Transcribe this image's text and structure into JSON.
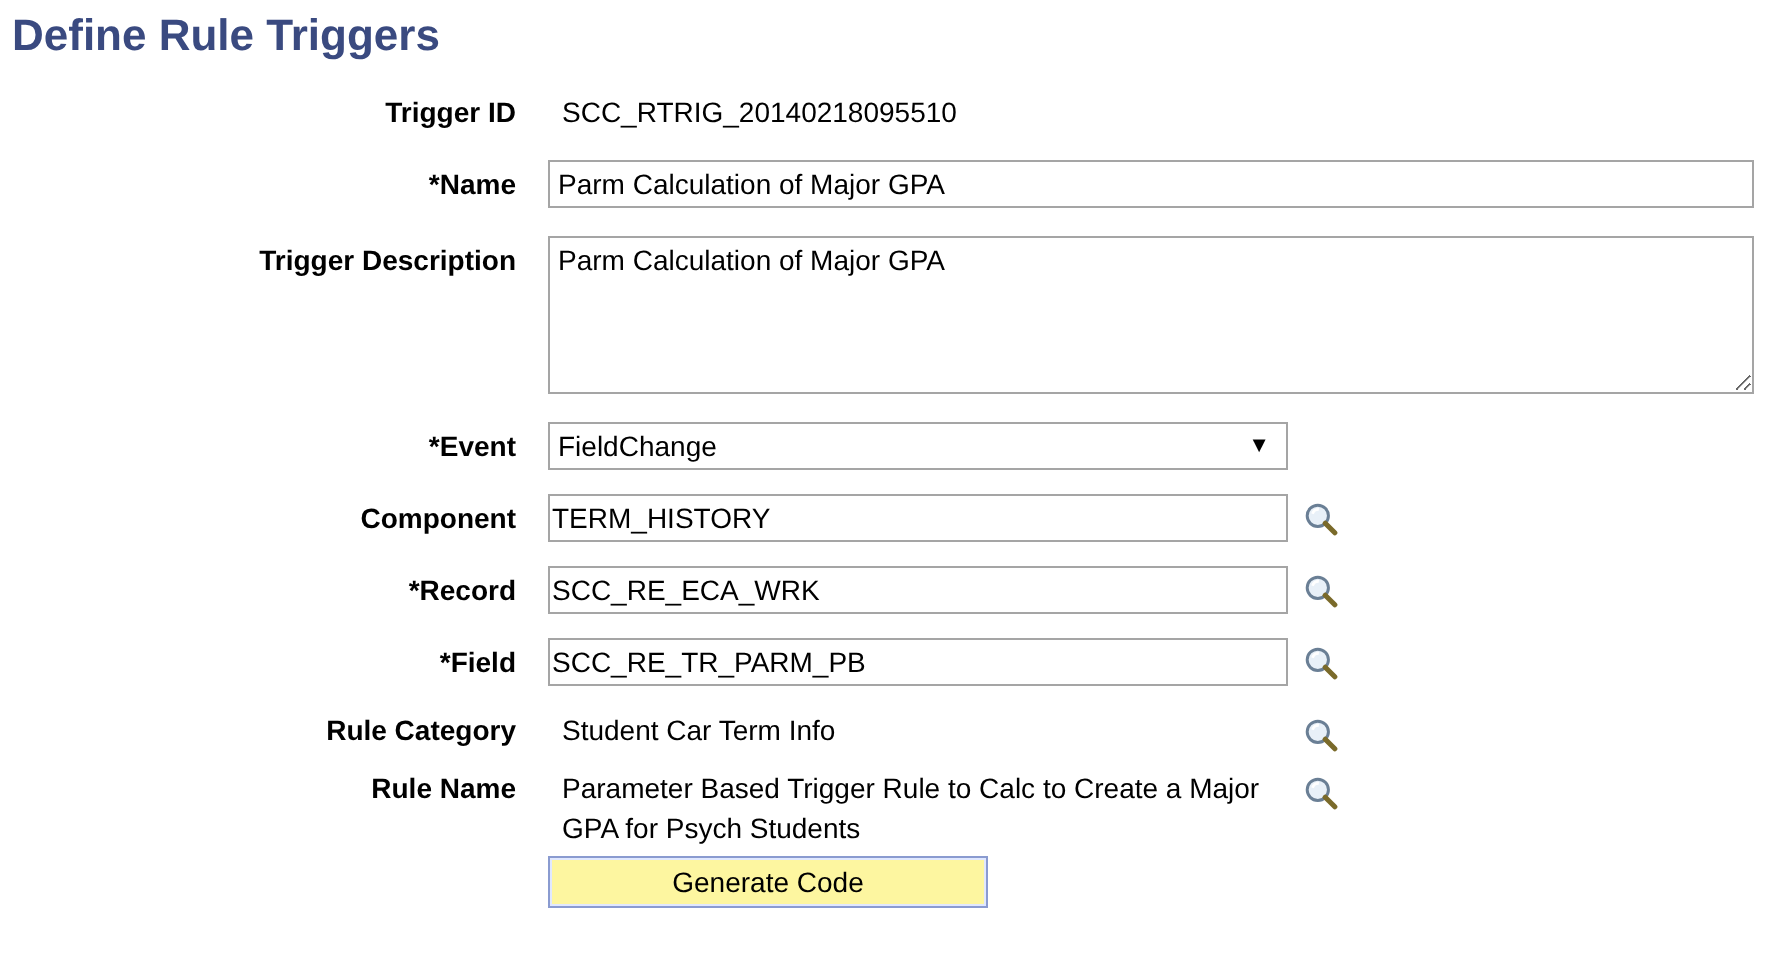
{
  "page": {
    "title": "Define Rule Triggers"
  },
  "fields": [
    {
      "kind": "display",
      "label": "Trigger ID",
      "value": "SCC_RTRIG_20140218095510"
    },
    {
      "kind": "input",
      "label": "*Name",
      "value": "Parm Calculation of Major GPA"
    },
    {
      "kind": "textarea",
      "label": "Trigger Description",
      "value": "Parm Calculation of Major GPA"
    },
    {
      "kind": "select",
      "label": "*Event",
      "value": "FieldChange",
      "arrow": "▼"
    },
    {
      "kind": "lookup",
      "label": "Component",
      "value": "TERM_HISTORY"
    },
    {
      "kind": "lookup",
      "label": "*Record",
      "value": "SCC_RE_ECA_WRK"
    },
    {
      "kind": "lookup",
      "label": "*Field",
      "value": "SCC_RE_TR_PARM_PB"
    },
    {
      "kind": "lookup_display",
      "label": "Rule Category",
      "value": "Student Car Term Info"
    },
    {
      "kind": "lookup_display",
      "label": "Rule Name",
      "value": "Parameter Based Trigger Rule to Calc to Create a Major GPA for Psych Students"
    }
  ],
  "button": {
    "label": "Generate Code"
  }
}
